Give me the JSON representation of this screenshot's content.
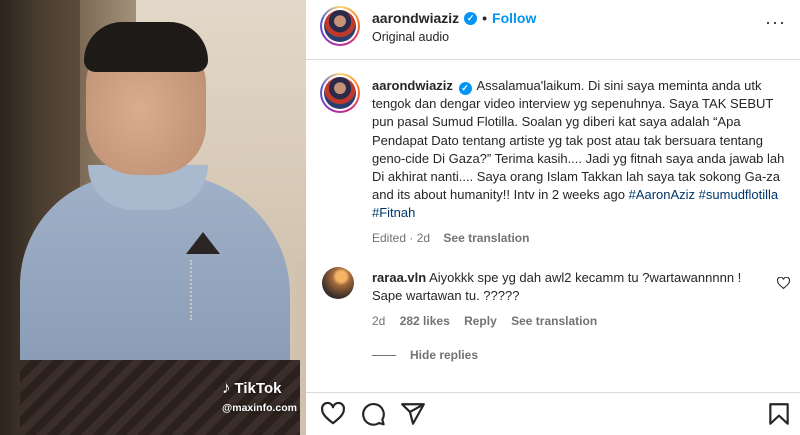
{
  "video": {
    "watermark_brand": "TikTok",
    "watermark_handle": "@maxinfo.com"
  },
  "header": {
    "username": "aarondwiaziz",
    "separator": "•",
    "follow_label": "Follow",
    "audio": "Original audio",
    "more_label": "···"
  },
  "caption": {
    "username": "aarondwiaziz",
    "text": "Assalamua'laikum. Di sini saya meminta anda utk tengok dan dengar video interview yg sepenuhnya. Saya TAK SEBUT pun pasal Sumud Flotilla. Soalan yg diberi kat saya adalah “Apa Pendapat Dato tentang artiste yg tak post atau tak bersuara tentang geno-cide Di Gaza?” Terima kasih.... Jadi yg fitnah saya anda jawab lah Di akhirat nanti.... Saya orang Islam Takkan lah saya tak sokong Ga-za and its about humanity!! Intv in 2 weeks ago",
    "hashtags": [
      "#AaronAziz",
      "#sumudflotilla",
      "#Fitnah"
    ],
    "edited": "Edited",
    "dot": "·",
    "time": "2d",
    "see_translation": "See translation"
  },
  "comment": {
    "username": "raraa.vln",
    "text": "Aiyokkk spe yg dah awl2 kecamm tu ?wartawannnnn ! Sape wartawan tu. ?????",
    "time": "2d",
    "likes": "282 likes",
    "reply": "Reply",
    "see_translation": "See translation",
    "hide_replies": "Hide replies"
  },
  "icons": [
    "heart-icon",
    "comment-icon",
    "share-icon",
    "bookmark-icon",
    "verified-icon",
    "more-icon",
    "tiktok-logo-icon"
  ],
  "colors": {
    "link_blue": "#0095f6",
    "hashtag": "#00376b",
    "muted": "#737373"
  }
}
